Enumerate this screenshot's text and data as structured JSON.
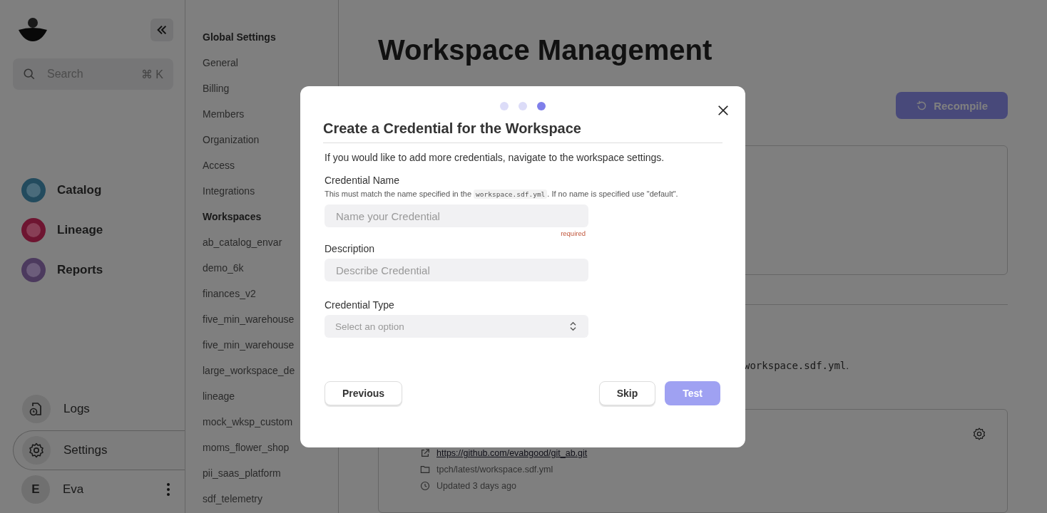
{
  "sidebar": {
    "search": {
      "placeholder": "Search",
      "shortcut": "⌘ K"
    },
    "nav": [
      {
        "label": "Catalog",
        "color": "#234b5e"
      },
      {
        "label": "Lineage",
        "color": "#6e1531"
      },
      {
        "label": "Reports",
        "color": "#4c3a5e"
      }
    ],
    "bottom": [
      {
        "label": "Logs",
        "kind": "logs",
        "selected": false
      },
      {
        "label": "Settings",
        "kind": "settings",
        "selected": true
      }
    ],
    "user": {
      "initial": "E",
      "name": "Eva"
    }
  },
  "settings_nav": {
    "sections": [
      {
        "heading": "Global Settings",
        "items": [
          "General",
          "Billing",
          "Members",
          "Organization",
          "Access",
          "Integrations"
        ]
      },
      {
        "heading": "Workspaces",
        "items": [
          "ab_catalog_envar",
          "demo_6k",
          "finances_v2",
          "five_min_warehouse",
          "five_min_warehouse",
          "large_workspace_de",
          "lineage",
          "mock_wksp_custom",
          "moms_flower_shop",
          "pii_saas_platform",
          "sdf_telemetry"
        ]
      }
    ]
  },
  "main": {
    "title": "Workspace Management",
    "recompile": "Recompile",
    "note": {
      "code": "workspace.sdf.yml",
      "after": "."
    },
    "repo": {
      "link": "https://github.com/evabgood/git_ab.git",
      "path": "tpch/latest/workspace.sdf.yml",
      "updated": "Updated 3 days ago"
    }
  },
  "dialog": {
    "steps": [
      {
        "selected": false
      },
      {
        "selected": false
      },
      {
        "selected": true
      }
    ],
    "title": "Create a Credential for the Workspace",
    "intro": "If you would like to add more credentials, navigate to the workspace settings.",
    "fields": [
      {
        "kind": "text",
        "label": "Credential Name",
        "help": {
          "before": "This must match the name specified in the ",
          "code": "workspace.sdf.yml",
          "after": ". If no name is specified use \"default\"."
        },
        "placeholder": "Name your Credential",
        "required": "required"
      },
      {
        "kind": "text",
        "label": "Description",
        "placeholder": "Describe Credential"
      },
      {
        "kind": "select",
        "label": "Credential Type",
        "placeholder": "Select an option"
      }
    ],
    "buttons": {
      "previous": "Previous",
      "skip": "Skip",
      "test": {
        "label": "Test",
        "disabled": true
      }
    }
  }
}
